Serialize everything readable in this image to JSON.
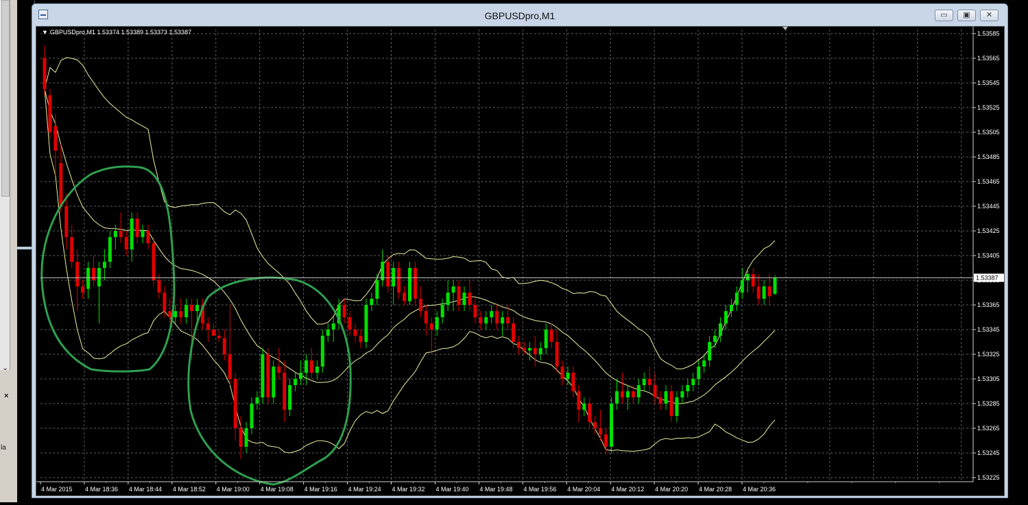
{
  "window": {
    "title": "GBPUSDpro,M1",
    "buttons": {
      "minimize": "▭",
      "restore": "▣",
      "close": "✕"
    }
  },
  "chart": {
    "symbol_info": "GBPUSDpro,M1  1.53374 1.53389 1.53373 1.53387",
    "current_price": "1.53387",
    "colors": {
      "background": "#000000",
      "grid": "#5e5e5e",
      "bull": "#00e000",
      "bear": "#e00000",
      "bands": "#f0f0a0",
      "annotation": "#2f9f4f",
      "axis_text": "#ffffff"
    }
  },
  "background": {
    "left_panel_chevron": "⌄",
    "left_panel_close": "×",
    "left_panel_label": "la"
  },
  "chart_data": {
    "type": "candlestick",
    "symbol": "GBPUSDpro",
    "timeframe": "M1",
    "ohlc_header": {
      "open": 1.53374,
      "high": 1.53389,
      "low": 1.53373,
      "close": 1.53387
    },
    "y_tick_labels": [
      "1.53585",
      "1.53565",
      "1.53545",
      "1.53525",
      "1.53505",
      "1.53485",
      "1.53465",
      "1.53445",
      "1.53425",
      "1.53405",
      "1.53385",
      "1.53365",
      "1.53345",
      "1.53325",
      "1.53305",
      "1.53285",
      "1.53265",
      "1.53245",
      "1.53225"
    ],
    "ylim": [
      1.53225,
      1.53585
    ],
    "x_tick_labels": [
      "4 Mar 2015",
      "4 Mar 18:36",
      "4 Mar 18:44",
      "4 Mar 18:52",
      "4 Mar 19:00",
      "4 Mar 19:08",
      "4 Mar 19:16",
      "4 Mar 19:24",
      "4 Mar 19:32",
      "4 Mar 19:40",
      "4 Mar 19:48",
      "4 Mar 19:56",
      "4 Mar 20:04",
      "4 Mar 20:12",
      "4 Mar 20:20",
      "4 Mar 20:28",
      "4 Mar 20:36"
    ],
    "grid": true,
    "indicators": [
      "bollinger-bands"
    ],
    "annotations": [
      "green-circle-1",
      "green-circle-2"
    ],
    "candles": [
      [
        1.53565,
        1.53575,
        1.53535,
        1.5354
      ],
      [
        1.53535,
        1.5354,
        1.535,
        1.53505
      ],
      [
        1.5351,
        1.5352,
        1.5347,
        1.5349
      ],
      [
        1.5348,
        1.53495,
        1.5344,
        1.53445
      ],
      [
        1.53445,
        1.53455,
        1.5341,
        1.5342
      ],
      [
        1.5342,
        1.5343,
        1.53395,
        1.534
      ],
      [
        1.534,
        1.5341,
        1.5336,
        1.5338
      ],
      [
        1.5338,
        1.53385,
        1.5337,
        1.53375
      ],
      [
        1.53378,
        1.534,
        1.5337,
        1.53395
      ],
      [
        1.53395,
        1.53405,
        1.5338,
        1.53385
      ],
      [
        1.5338,
        1.534,
        1.5335,
        1.53395
      ],
      [
        1.53395,
        1.5341,
        1.53385,
        1.534
      ],
      [
        1.534,
        1.53425,
        1.53395,
        1.5342
      ],
      [
        1.5342,
        1.5343,
        1.5341,
        1.53425
      ],
      [
        1.53425,
        1.5344,
        1.53415,
        1.5342
      ],
      [
        1.5342,
        1.53425,
        1.53405,
        1.5341
      ],
      [
        1.5341,
        1.5344,
        1.534,
        1.53435
      ],
      [
        1.53435,
        1.5344,
        1.53415,
        1.5342
      ],
      [
        1.5342,
        1.5343,
        1.53415,
        1.53425
      ],
      [
        1.53425,
        1.5343,
        1.5341,
        1.53415
      ],
      [
        1.53415,
        1.5342,
        1.5338,
        1.53385
      ],
      [
        1.53385,
        1.5339,
        1.5337,
        1.53375
      ],
      [
        1.53375,
        1.5338,
        1.53355,
        1.5336
      ],
      [
        1.5336,
        1.5337,
        1.5335,
        1.53355
      ],
      [
        1.53355,
        1.53365,
        1.5335,
        1.5336
      ],
      [
        1.5336,
        1.5337,
        1.5335,
        1.53355
      ],
      [
        1.53355,
        1.5337,
        1.5335,
        1.53365
      ],
      [
        1.53365,
        1.5337,
        1.5332,
        1.5336
      ],
      [
        1.5336,
        1.5337,
        1.5335,
        1.53365
      ],
      [
        1.53365,
        1.5337,
        1.53345,
        1.5335
      ],
      [
        1.5335,
        1.53355,
        1.53335,
        1.53345
      ],
      [
        1.53345,
        1.5335,
        1.5334,
        1.5334
      ],
      [
        1.5334,
        1.53345,
        1.53335,
        1.53338
      ],
      [
        1.53338,
        1.53345,
        1.5332,
        1.53325
      ],
      [
        1.53325,
        1.53365,
        1.533,
        1.53305
      ],
      [
        1.53305,
        1.5331,
        1.53255,
        1.53265
      ],
      [
        1.53265,
        1.53275,
        1.5324,
        1.5325
      ],
      [
        1.5325,
        1.5327,
        1.53245,
        1.53265
      ],
      [
        1.53265,
        1.5329,
        1.5326,
        1.53285
      ],
      [
        1.53285,
        1.53295,
        1.5328,
        1.5329
      ],
      [
        1.5329,
        1.5333,
        1.53285,
        1.53325
      ],
      [
        1.53325,
        1.5333,
        1.53285,
        1.5329
      ],
      [
        1.5329,
        1.5332,
        1.53285,
        1.53315
      ],
      [
        1.53315,
        1.5333,
        1.53305,
        1.5331
      ],
      [
        1.5331,
        1.5332,
        1.5327,
        1.5328
      ],
      [
        1.5328,
        1.53305,
        1.53275,
        1.533
      ],
      [
        1.533,
        1.5331,
        1.53295,
        1.53305
      ],
      [
        1.53305,
        1.5332,
        1.533,
        1.5331
      ],
      [
        1.5331,
        1.53325,
        1.533,
        1.5332
      ],
      [
        1.5332,
        1.5333,
        1.53305,
        1.5331
      ],
      [
        1.5331,
        1.5332,
        1.53305,
        1.53315
      ],
      [
        1.53315,
        1.53345,
        1.5331,
        1.5334
      ],
      [
        1.5334,
        1.5335,
        1.53335,
        1.53345
      ],
      [
        1.53345,
        1.53355,
        1.53335,
        1.5335
      ],
      [
        1.5335,
        1.5337,
        1.53345,
        1.53365
      ],
      [
        1.53365,
        1.5337,
        1.5335,
        1.53355
      ],
      [
        1.53355,
        1.5336,
        1.5334,
        1.53345
      ],
      [
        1.53345,
        1.5335,
        1.53335,
        1.5334
      ],
      [
        1.5334,
        1.53345,
        1.5333,
        1.53335
      ],
      [
        1.53335,
        1.5337,
        1.5333,
        1.53365
      ],
      [
        1.53365,
        1.53375,
        1.5336,
        1.5337
      ],
      [
        1.5337,
        1.5339,
        1.53365,
        1.53385
      ],
      [
        1.53385,
        1.5341,
        1.5338,
        1.534
      ],
      [
        1.534,
        1.53405,
        1.53375,
        1.5338
      ],
      [
        1.5338,
        1.534,
        1.53365,
        1.53395
      ],
      [
        1.53395,
        1.534,
        1.5337,
        1.53375
      ],
      [
        1.53375,
        1.5338,
        1.53365,
        1.53368
      ],
      [
        1.53368,
        1.534,
        1.53365,
        1.53395
      ],
      [
        1.53395,
        1.534,
        1.53365,
        1.5337
      ],
      [
        1.5337,
        1.5338,
        1.53355,
        1.5336
      ],
      [
        1.5336,
        1.53365,
        1.5334,
        1.5335
      ],
      [
        1.5335,
        1.53355,
        1.53325,
        1.53345
      ],
      [
        1.53345,
        1.5336,
        1.5334,
        1.53355
      ],
      [
        1.53355,
        1.5337,
        1.5335,
        1.53365
      ],
      [
        1.53365,
        1.53385,
        1.5336,
        1.53375
      ],
      [
        1.53375,
        1.53385,
        1.5336,
        1.5338
      ],
      [
        1.5338,
        1.53385,
        1.5336,
        1.53365
      ],
      [
        1.53365,
        1.5338,
        1.5336,
        1.53375
      ],
      [
        1.53375,
        1.53385,
        1.5336,
        1.53365
      ],
      [
        1.53365,
        1.5337,
        1.5335,
        1.53355
      ],
      [
        1.53355,
        1.5336,
        1.53345,
        1.5335
      ],
      [
        1.5335,
        1.5336,
        1.53345,
        1.53355
      ],
      [
        1.53355,
        1.53365,
        1.5335,
        1.5336
      ],
      [
        1.5336,
        1.53365,
        1.53345,
        1.5335
      ],
      [
        1.5335,
        1.5336,
        1.5334,
        1.53355
      ],
      [
        1.53355,
        1.53365,
        1.53345,
        1.5335
      ],
      [
        1.5335,
        1.53355,
        1.5333,
        1.53335
      ],
      [
        1.53335,
        1.5334,
        1.53325,
        1.5333
      ],
      [
        1.5333,
        1.53335,
        1.53325,
        1.53328
      ],
      [
        1.53328,
        1.53335,
        1.5332,
        1.5333
      ],
      [
        1.5333,
        1.5334,
        1.53315,
        1.53325
      ],
      [
        1.53325,
        1.53335,
        1.5332,
        1.5333
      ],
      [
        1.5333,
        1.5335,
        1.53325,
        1.53345
      ],
      [
        1.53345,
        1.5335,
        1.5333,
        1.53335
      ],
      [
        1.53335,
        1.53345,
        1.5331,
        1.53315
      ],
      [
        1.53315,
        1.5332,
        1.533,
        1.53305
      ],
      [
        1.53305,
        1.53315,
        1.533,
        1.5331
      ],
      [
        1.5331,
        1.53315,
        1.5329,
        1.53295
      ],
      [
        1.53295,
        1.533,
        1.5327,
        1.5328
      ],
      [
        1.5328,
        1.5329,
        1.53275,
        1.53285
      ],
      [
        1.53285,
        1.5329,
        1.53265,
        1.5327
      ],
      [
        1.5327,
        1.53275,
        1.5326,
        1.53265
      ],
      [
        1.53265,
        1.5328,
        1.53255,
        1.5326
      ],
      [
        1.5326,
        1.53265,
        1.53245,
        1.5325
      ],
      [
        1.5325,
        1.5329,
        1.53245,
        1.53285
      ],
      [
        1.53285,
        1.53305,
        1.5328,
        1.53295
      ],
      [
        1.53295,
        1.5331,
        1.53285,
        1.5329
      ],
      [
        1.5329,
        1.533,
        1.5328,
        1.53295
      ],
      [
        1.53295,
        1.533,
        1.53285,
        1.5329
      ],
      [
        1.5329,
        1.53305,
        1.53285,
        1.533
      ],
      [
        1.533,
        1.5331,
        1.53295,
        1.53305
      ],
      [
        1.53305,
        1.53315,
        1.53295,
        1.533
      ],
      [
        1.533,
        1.5331,
        1.53285,
        1.5329
      ],
      [
        1.5329,
        1.53295,
        1.5328,
        1.53285
      ],
      [
        1.53285,
        1.533,
        1.5328,
        1.53295
      ],
      [
        1.53295,
        1.533,
        1.5327,
        1.53275
      ],
      [
        1.53275,
        1.53295,
        1.5327,
        1.5329
      ],
      [
        1.5329,
        1.533,
        1.53285,
        1.53295
      ],
      [
        1.53295,
        1.53305,
        1.5329,
        1.533
      ],
      [
        1.533,
        1.5331,
        1.53295,
        1.53305
      ],
      [
        1.53305,
        1.5332,
        1.533,
        1.53315
      ],
      [
        1.53315,
        1.53325,
        1.5331,
        1.5332
      ],
      [
        1.5332,
        1.5334,
        1.53315,
        1.53335
      ],
      [
        1.53335,
        1.53345,
        1.5333,
        1.5334
      ],
      [
        1.5334,
        1.53355,
        1.53335,
        1.5335
      ],
      [
        1.5335,
        1.53365,
        1.53345,
        1.5336
      ],
      [
        1.5336,
        1.5337,
        1.53355,
        1.53365
      ],
      [
        1.53365,
        1.5338,
        1.5336,
        1.53375
      ],
      [
        1.53375,
        1.53395,
        1.5337,
        1.53385
      ],
      [
        1.53385,
        1.53395,
        1.53375,
        1.5339
      ],
      [
        1.5339,
        1.53395,
        1.53375,
        1.5338
      ],
      [
        1.5338,
        1.5339,
        1.53365,
        1.5337
      ],
      [
        1.5337,
        1.53385,
        1.53365,
        1.5338
      ],
      [
        1.5338,
        1.5339,
        1.53365,
        1.53372
      ],
      [
        1.53374,
        1.53389,
        1.53373,
        1.53387
      ]
    ]
  }
}
